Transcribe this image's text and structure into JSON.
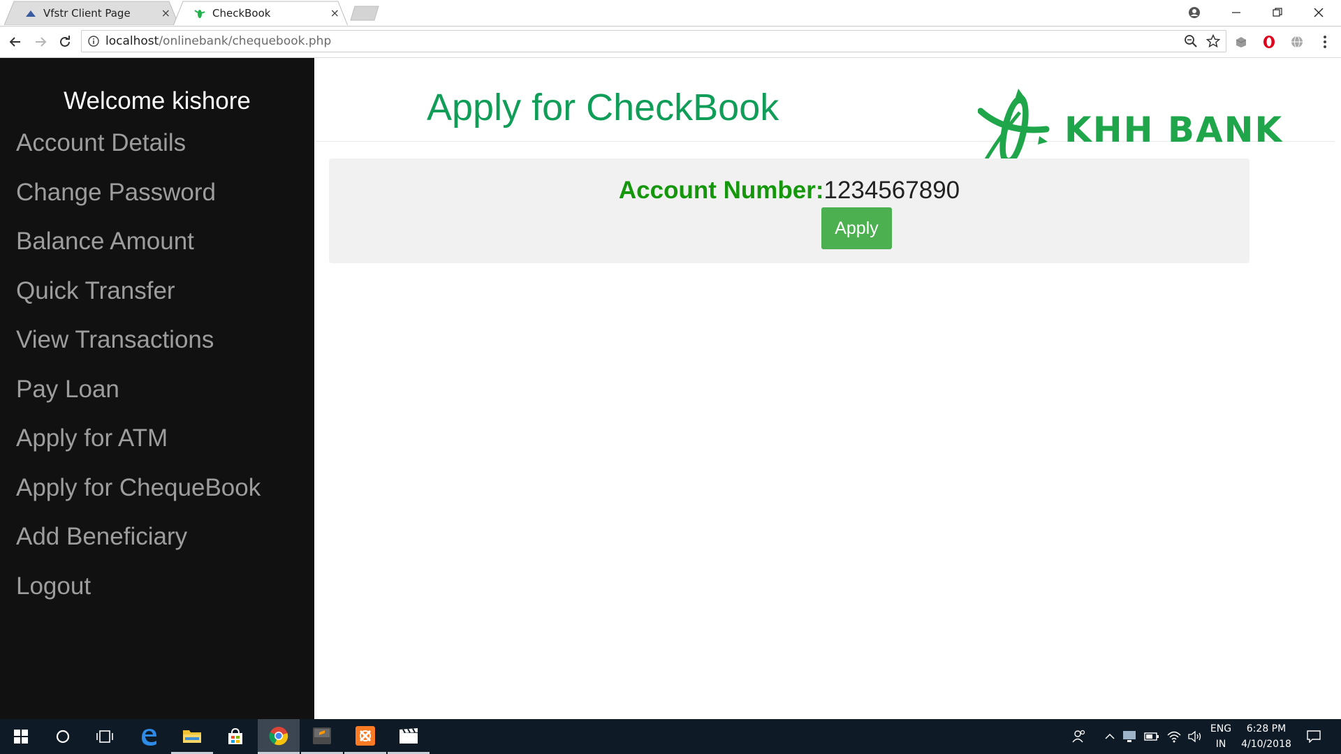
{
  "browser": {
    "tabs": [
      {
        "title": "Vfstr Client Page",
        "close": "×",
        "active": false
      },
      {
        "title": "CheckBook",
        "close": "×",
        "active": true
      }
    ],
    "url_host": "localhost",
    "url_path": "/onlinebank/chequebook.php"
  },
  "sidebar": {
    "welcome": "Welcome kishore",
    "items": [
      {
        "label": "Account Details"
      },
      {
        "label": "Change Password"
      },
      {
        "label": "Balance Amount"
      },
      {
        "label": "Quick Transfer"
      },
      {
        "label": "View Transactions"
      },
      {
        "label": "Pay Loan"
      },
      {
        "label": "Apply for ATM"
      },
      {
        "label": "Apply for ChequeBook"
      },
      {
        "label": "Add Beneficiary"
      },
      {
        "label": "Logout"
      }
    ]
  },
  "main": {
    "title": "Apply for CheckBook",
    "logo_text": "KHH BANK",
    "account_label": "Account Number:",
    "account_number": "1234567890",
    "apply_label": "Apply"
  },
  "taskbar": {
    "language_top": "ENG",
    "language_bottom": "IN",
    "time": "6:28 PM",
    "date": "4/10/2018"
  },
  "colors": {
    "title_green": "#0f9d58",
    "label_green": "#15970c",
    "button_green": "#4caf50",
    "sidebar_bg": "#111111",
    "sidebar_text": "#9d9d9d"
  }
}
